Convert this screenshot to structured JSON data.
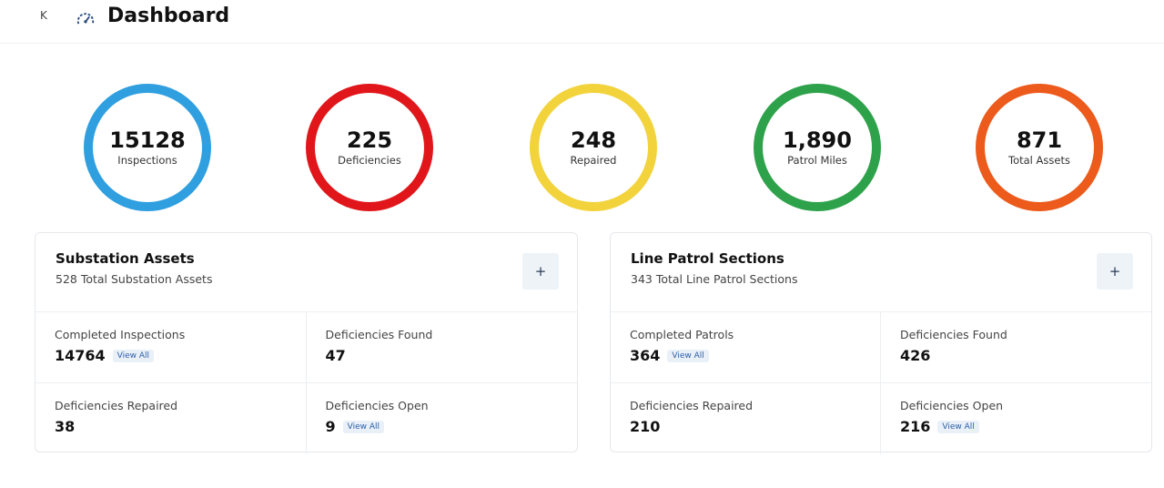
{
  "header": {
    "title": "Dashboard"
  },
  "kpis": [
    {
      "value": "15128",
      "label": "Inspections",
      "color": "#2f9fe0"
    },
    {
      "value": "225",
      "label": "Deficiencies",
      "color": "#e0161a"
    },
    {
      "value": "248",
      "label": "Repaired",
      "color": "#f2d33c"
    },
    {
      "value": "1,890",
      "label": "Patrol Miles",
      "color": "#2ea24a"
    },
    {
      "value": "871",
      "label": "Total Assets",
      "color": "#ec5a1c"
    }
  ],
  "substation": {
    "title": "Substation Assets",
    "subtitle": "528 Total Substation Assets",
    "plus": "+",
    "cells": [
      {
        "label": "Completed Inspections",
        "value": "14764",
        "link": "View All"
      },
      {
        "label": "Deficiencies Found",
        "value": "47"
      },
      {
        "label": "Deficiencies Repaired",
        "value": "38"
      },
      {
        "label": "Deficiencies Open",
        "value": "9",
        "link": "View All"
      }
    ]
  },
  "line_patrol": {
    "title": "Line Patrol Sections",
    "subtitle": "343 Total Line Patrol Sections",
    "plus": "+",
    "cells": [
      {
        "label": "Completed Patrols",
        "value": "364",
        "link": "View All"
      },
      {
        "label": "Deficiencies Found",
        "value": "426"
      },
      {
        "label": "Deficiencies Repaired",
        "value": "210"
      },
      {
        "label": "Deficiencies Open",
        "value": "216",
        "link": "View All"
      }
    ]
  }
}
